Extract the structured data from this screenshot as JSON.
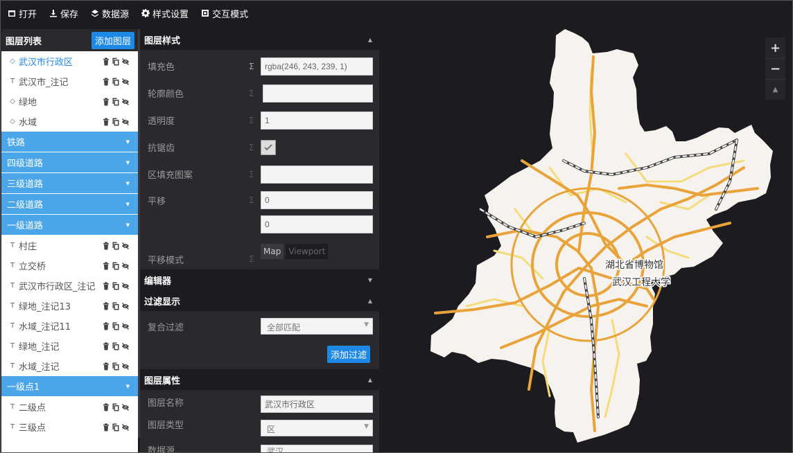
{
  "toolbar": {
    "open": "打开",
    "save": "保存",
    "datasource": "数据源",
    "style_settings": "样式设置",
    "interaction_mode": "交互模式"
  },
  "layers": {
    "title": "图层列表",
    "add_button": "添加图层",
    "items": [
      {
        "label": "武汉市行政区",
        "type": "fill",
        "selected": true
      },
      {
        "label": "武汉市_注记",
        "type": "symbol"
      },
      {
        "label": "绿地",
        "type": "fill"
      },
      {
        "label": "水域",
        "type": "fill"
      },
      {
        "label": "铁路",
        "group": true
      },
      {
        "label": "四级道路",
        "group": true
      },
      {
        "label": "三级道路",
        "group": true
      },
      {
        "label": "二级道路",
        "group": true
      },
      {
        "label": "一级道路",
        "group": true
      },
      {
        "label": "村庄",
        "type": "symbol"
      },
      {
        "label": "立交桥",
        "type": "symbol"
      },
      {
        "label": "武汉市行政区_注记",
        "type": "symbol"
      },
      {
        "label": "绿地_注记13",
        "type": "symbol"
      },
      {
        "label": "水域_注记11",
        "type": "symbol"
      },
      {
        "label": "绿地_注记",
        "type": "symbol"
      },
      {
        "label": "水域_注记",
        "type": "symbol"
      },
      {
        "label": "一级点1",
        "group": true
      },
      {
        "label": "二级点",
        "type": "symbol"
      },
      {
        "label": "三级点",
        "type": "symbol"
      }
    ]
  },
  "style": {
    "section_title": "图层样式",
    "fill_color_label": "填充色",
    "fill_color_value": "rgba(246, 243, 239, 1)",
    "outline_color_label": "轮廓颜色",
    "outline_color_value": "",
    "opacity_label": "透明度",
    "opacity_value": "1",
    "antialias_label": "抗锯齿",
    "antialias_checked": true,
    "pattern_label": "区填充图案",
    "pattern_value": "",
    "translate_label": "平移",
    "translate_x": "0",
    "translate_y": "0",
    "translate_anchor_label": "平移模式",
    "translate_anchor_options": [
      "Map",
      "Viewport"
    ],
    "translate_anchor_selected": "Map"
  },
  "editor": {
    "section_title": "编辑器"
  },
  "filter": {
    "section_title": "过滤显示",
    "compound_label": "复合过滤",
    "compound_value": "全部匹配",
    "add_button": "添加过滤"
  },
  "properties": {
    "section_title": "图层属性",
    "name_label": "图层名称",
    "name_value": "武汉市行政区",
    "type_label": "图层类型",
    "type_value": "区",
    "source_label": "数据源",
    "source_value": "武汉"
  },
  "map": {
    "labels": [
      "湖北省博物馆",
      "武汉工程大学"
    ],
    "zoom_in": "+",
    "zoom_out": "−",
    "compass": "▲",
    "colors": {
      "land": "#f6f3ef",
      "major_road": "#e8a33a",
      "minor_road": "#f4dc7c",
      "railway": "#444444",
      "background": "#1c1c20",
      "accent": "#1e88e5",
      "group_row": "#4aa5e9"
    }
  }
}
